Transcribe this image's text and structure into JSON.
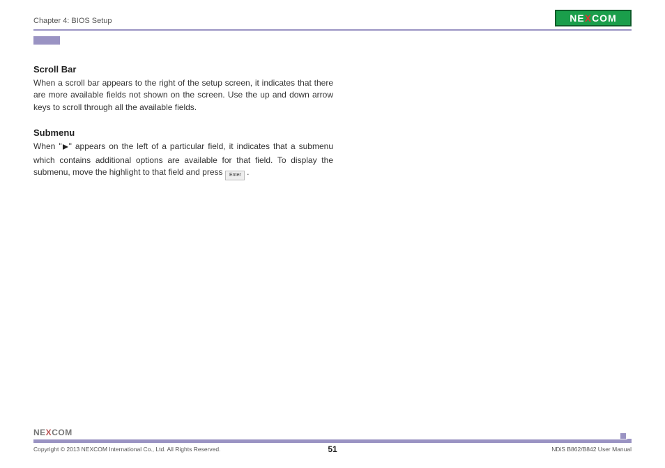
{
  "header": {
    "chapter": "Chapter 4: BIOS Setup",
    "logo_pre": "NE",
    "logo_x": "X",
    "logo_post": "COM"
  },
  "sections": {
    "scrollbar": {
      "heading": "Scroll Bar",
      "body": "When a scroll bar appears to the right of the setup screen, it indicates that there are more available fields not shown on the screen. Use the up and down arrow keys to scroll through all the available fields."
    },
    "submenu": {
      "heading": "Submenu",
      "body_pre": "When \"",
      "body_mid": "\" appears on the left of a particular field, it indicates that a submenu which contains additional options are available for that field. To display the submenu, move the highlight to that field and press ",
      "key_label": "Enter",
      "body_post": " ."
    }
  },
  "footer": {
    "logo_pre": "NE",
    "logo_x": "X",
    "logo_post": "COM",
    "copyright": "Copyright © 2013 NEXCOM International Co., Ltd. All Rights Reserved.",
    "page_number": "51",
    "doc_id": "NDiS B862/B842 User Manual"
  }
}
